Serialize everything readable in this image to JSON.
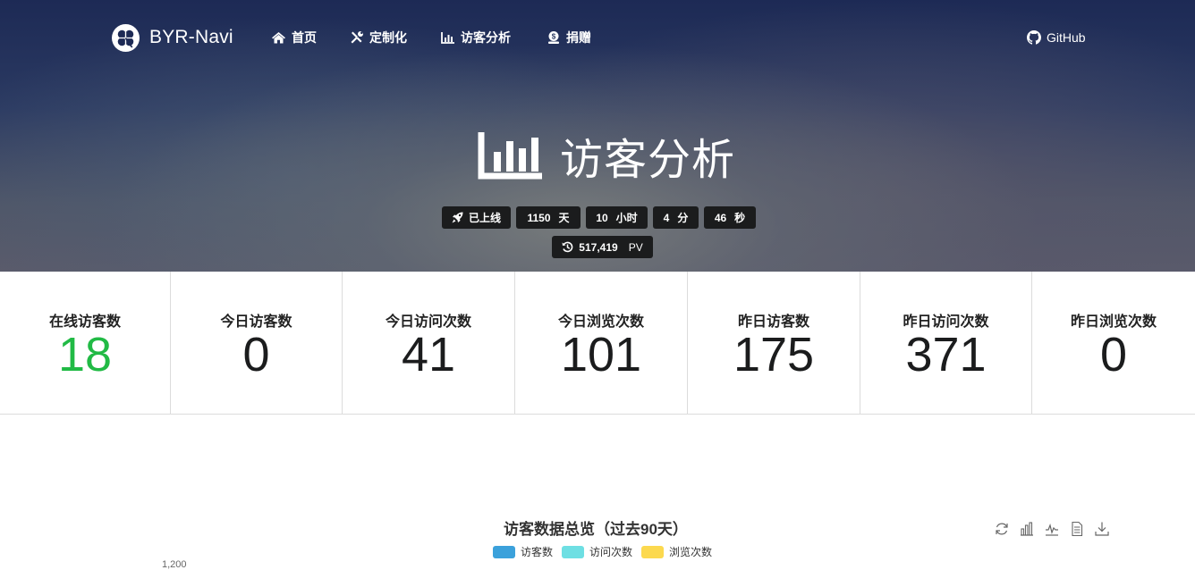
{
  "nav": {
    "brand": "BYR-Navi",
    "items": [
      {
        "label": "首页",
        "icon": "home-icon"
      },
      {
        "label": "定制化",
        "icon": "tools-icon"
      },
      {
        "label": "访客分析",
        "icon": "chart-bar-icon"
      },
      {
        "label": "捐赠",
        "icon": "donate-icon"
      }
    ],
    "github": {
      "label": "GitHub",
      "icon": "github-icon"
    }
  },
  "hero": {
    "title": "访客分析",
    "icon": "chart-bar-icon",
    "uptime": {
      "label": "已上线",
      "days": "1150",
      "days_unit": "天",
      "hours": "10",
      "hours_unit": "小时",
      "minutes": "4",
      "minutes_unit": "分",
      "seconds": "46",
      "seconds_unit": "秒"
    },
    "pv": {
      "value": "517,419",
      "unit": "PV",
      "icon": "history-icon"
    }
  },
  "stats": [
    {
      "label": "在线访客数",
      "value": "18",
      "color": "#21ba45"
    },
    {
      "label": "今日访客数",
      "value": "0"
    },
    {
      "label": "今日访问次数",
      "value": "41"
    },
    {
      "label": "今日浏览次数",
      "value": "101"
    },
    {
      "label": "昨日访客数",
      "value": "175"
    },
    {
      "label": "昨日访问次数",
      "value": "371"
    },
    {
      "label": "昨日浏览次数",
      "value": "0"
    }
  ],
  "chart": {
    "title": "访客数据总览（过去90天）",
    "legend": [
      {
        "label": "访客数",
        "color": "#3ba1db"
      },
      {
        "label": "访问次数",
        "color": "#6edfe3"
      },
      {
        "label": "浏览次数",
        "color": "#fcd94f"
      }
    ],
    "toolbox": [
      "refresh-icon",
      "bar-chart-icon",
      "line-chart-icon",
      "data-view-icon",
      "download-icon"
    ],
    "first_y_tick": "1,200"
  }
}
